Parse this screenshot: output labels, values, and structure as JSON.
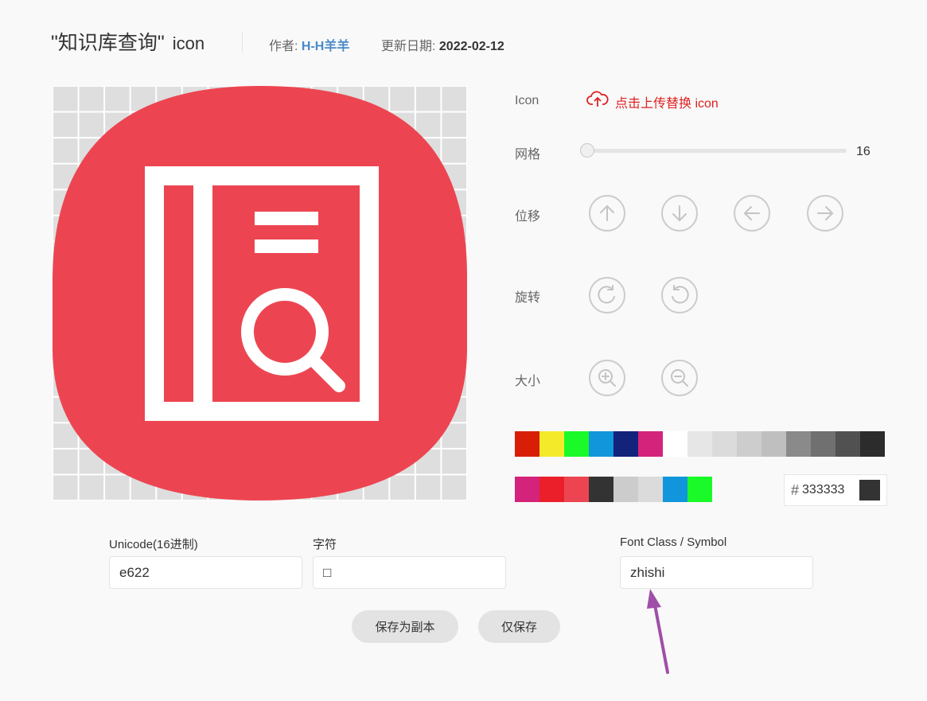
{
  "header": {
    "title": "\"知识库查询\"",
    "title_suffix": "icon",
    "author_label": "作者:",
    "author_value": "H-H羊羊",
    "date_label": "更新日期:",
    "date_value": "2022-02-12"
  },
  "canvas": {
    "grid": 16,
    "icon": "knowledge-base-search-icon",
    "icon_colors": {
      "background": "#ec4551",
      "glyph": "#ffffff"
    }
  },
  "panel": {
    "icon_label": "Icon",
    "upload_label": "点击上传替换 icon",
    "grid_label": "网格",
    "grid_value": "16",
    "move_label": "位移",
    "rotate_label": "旋转",
    "size_label": "大小"
  },
  "palette_row1": [
    "#d81e06",
    "#f4ea2a",
    "#1afa29",
    "#1296db",
    "#13227a",
    "#d4237a",
    "#ffffff",
    "#e6e6e6",
    "#dbdbdb",
    "#cdcdcd",
    "#bfbfbf",
    "#8a8a8a",
    "#707070",
    "#515151",
    "#2c2c2c"
  ],
  "palette_row2": [
    "#d4237a",
    "#ea1f2a",
    "#ec4551",
    "#333333",
    "#cccccc",
    "#dbdbdb",
    "#1296db",
    "#1afa29"
  ],
  "color_input": {
    "hash": "#",
    "value": "333333",
    "swatch": "#333333"
  },
  "form": {
    "unicode_label": "Unicode(16进制)",
    "unicode_value": "e622",
    "char_label": "字符",
    "char_value": "□",
    "class_label": "Font Class / Symbol",
    "class_value": "zhishi"
  },
  "buttons": {
    "save_copy": "保存为副本",
    "save_only": "仅保存"
  },
  "annotation": {
    "color": "#a04fa8",
    "points_to": "font-class-input"
  }
}
